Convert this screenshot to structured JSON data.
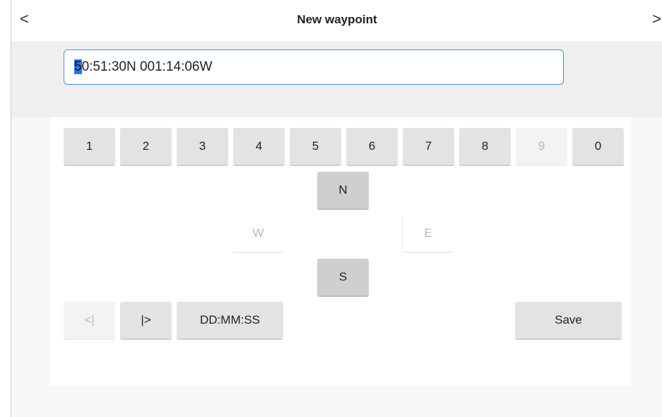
{
  "header": {
    "title": "New waypoint",
    "back_icon": "<",
    "forward_icon": ">"
  },
  "coordinate_input": {
    "cursor_char": "5",
    "rest": "0:51:30N  001:14:06W"
  },
  "digits": [
    {
      "label": "1",
      "enabled": true
    },
    {
      "label": "2",
      "enabled": true
    },
    {
      "label": "3",
      "enabled": true
    },
    {
      "label": "4",
      "enabled": true
    },
    {
      "label": "5",
      "enabled": true
    },
    {
      "label": "6",
      "enabled": true
    },
    {
      "label": "7",
      "enabled": true
    },
    {
      "label": "8",
      "enabled": true
    },
    {
      "label": "9",
      "enabled": false
    },
    {
      "label": "0",
      "enabled": true
    }
  ],
  "directions": {
    "north": {
      "label": "N",
      "enabled": true
    },
    "west": {
      "label": "W",
      "enabled": false
    },
    "east": {
      "label": "E",
      "enabled": false
    },
    "south": {
      "label": "S",
      "enabled": true
    }
  },
  "controls": {
    "cursor_left": {
      "label": "<|",
      "enabled": false
    },
    "cursor_right": {
      "label": "|>",
      "enabled": true
    },
    "format": {
      "label": "DD:MM:SS"
    },
    "save": {
      "label": "Save"
    }
  }
}
